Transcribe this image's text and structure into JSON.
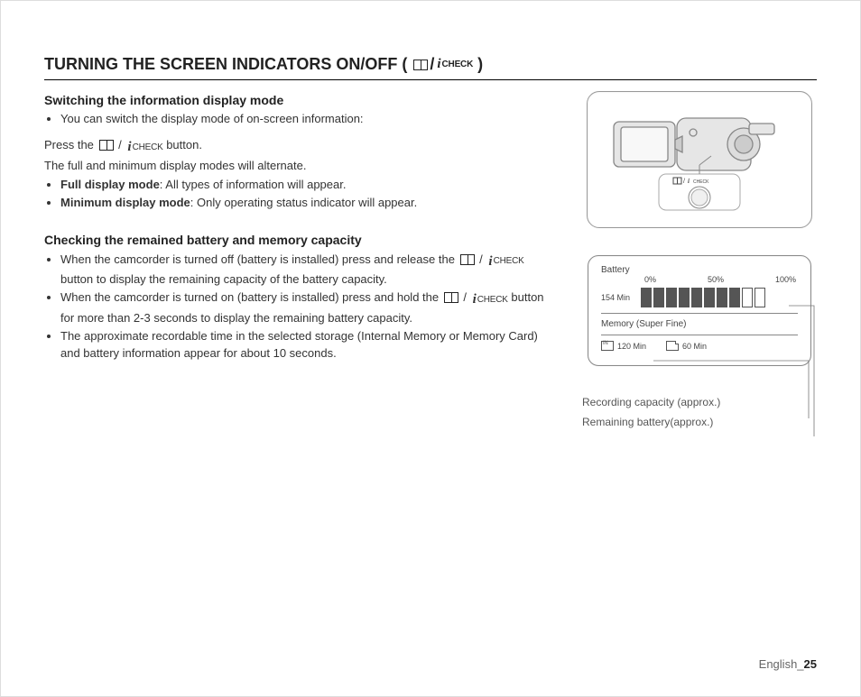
{
  "title": {
    "left": "TURNING THE SCREEN INDICATORS ON/OFF ( ",
    "right": " )",
    "icon_slash": " / ",
    "icon_check_label": "CHECK"
  },
  "sections": {
    "switching": {
      "heading": "Switching the information display mode",
      "bullet1": "You can switch the display mode of on-screen information:",
      "press_line_pre": "Press the ",
      "press_line_post": " button.",
      "alternate_line": "The full and minimum display modes will alternate.",
      "full_label": "Full display mode",
      "full_text": ": All types of information will appear.",
      "min_label": "Minimum display mode",
      "min_text": ": Only operating status indicator will appear."
    },
    "checking": {
      "heading": "Checking the remained battery and memory capacity",
      "b1_pre": "When the camcorder is turned off (battery is installed) press and release the ",
      "b1_post": " button to display the remaining capacity of the battery capacity.",
      "b2_pre": "When the camcorder is turned on (battery is installed) press and hold the ",
      "b2_post": " button for more than 2-3 seconds to display the remaining battery capacity.",
      "b3": "The approximate recordable time in the selected storage (Internal Memory or Memory Card) and battery information appear for about 10 seconds."
    }
  },
  "diagram": {
    "button_icon_check": "CHECK"
  },
  "panel": {
    "battery_label": "Battery",
    "scale": {
      "p0": "0%",
      "p50": "50%",
      "p100": "100%"
    },
    "battery_min": "154 Min",
    "bars_filled": 8,
    "bars_total": 10,
    "memory_label": "Memory (Super Fine)",
    "mem_in": "120 Min",
    "mem_card": "60 Min"
  },
  "callouts": {
    "recording": "Recording capacity (approx.)",
    "remaining": "Remaining battery(approx.)"
  },
  "footer": {
    "lang": "English_",
    "page": "25"
  },
  "chart_data": {
    "type": "bar",
    "title": "Battery",
    "categories": [
      "filled",
      "filled",
      "filled",
      "filled",
      "filled",
      "filled",
      "filled",
      "filled",
      "empty",
      "empty"
    ],
    "values": [
      1,
      1,
      1,
      1,
      1,
      1,
      1,
      1,
      0,
      0
    ],
    "xlabel": "",
    "ylabel": "battery level",
    "ylim": [
      0,
      100
    ],
    "annotations": {
      "remaining_time": "154 Min",
      "ticks": [
        "0%",
        "50%",
        "100%"
      ],
      "memory_super_fine": {
        "internal": "120 Min",
        "card": "60 Min"
      }
    }
  }
}
